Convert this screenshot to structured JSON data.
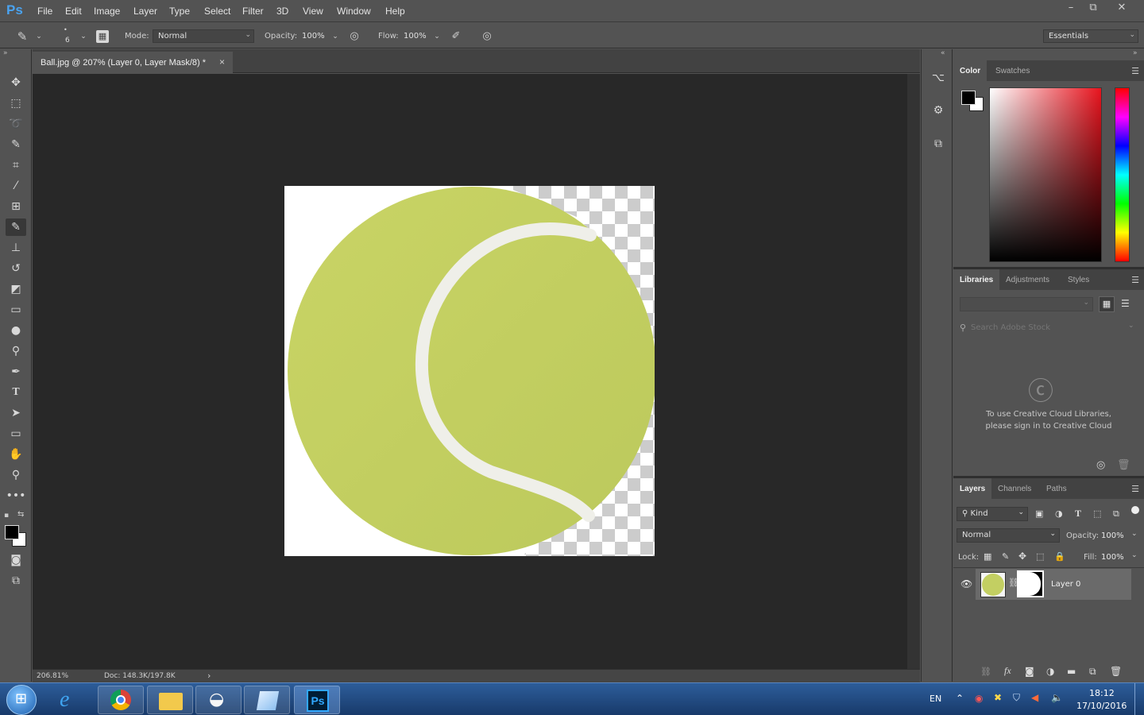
{
  "app": {
    "logo": "Ps"
  },
  "menu": [
    "File",
    "Edit",
    "Image",
    "Layer",
    "Type",
    "Select",
    "Filter",
    "3D",
    "View",
    "Window",
    "Help"
  ],
  "window_controls": {
    "minimize": "–",
    "restore": "⧉",
    "close": "✕"
  },
  "options": {
    "brush_size": "6",
    "mode_label": "Mode:",
    "mode_value": "Normal",
    "opacity_label": "Opacity:",
    "opacity_value": "100%",
    "flow_label": "Flow:",
    "flow_value": "100%",
    "workspace": "Essentials"
  },
  "document": {
    "tab_title": "Ball.jpg @ 207% (Layer 0, Layer Mask/8) *",
    "zoom": "206.81%",
    "doc_size": "Doc: 148.3K/197.8K"
  },
  "color_panel": {
    "tabs": [
      "Color",
      "Swatches"
    ],
    "foreground": "#000000",
    "background": "#ffffff"
  },
  "libraries_panel": {
    "tabs": [
      "Libraries",
      "Adjustments",
      "Styles"
    ],
    "search_placeholder": "Search Adobe Stock",
    "message": "To use Creative Cloud Libraries, please sign in to Creative Cloud"
  },
  "layers_panel": {
    "tabs": [
      "Layers",
      "Channels",
      "Paths"
    ],
    "filter_kind": "Kind",
    "blend_mode": "Normal",
    "opacity_label": "Opacity:",
    "opacity_value": "100%",
    "lock_label": "Lock:",
    "fill_label": "Fill:",
    "fill_value": "100%",
    "layers": [
      {
        "name": "Layer 0",
        "visible": true
      }
    ]
  },
  "taskbar": {
    "lang": "EN",
    "time": "18:12",
    "date": "17/10/2016"
  },
  "colors": {
    "ball": "#c3cf62",
    "seam": "#efefe9",
    "accent": "#4aa3f0"
  }
}
